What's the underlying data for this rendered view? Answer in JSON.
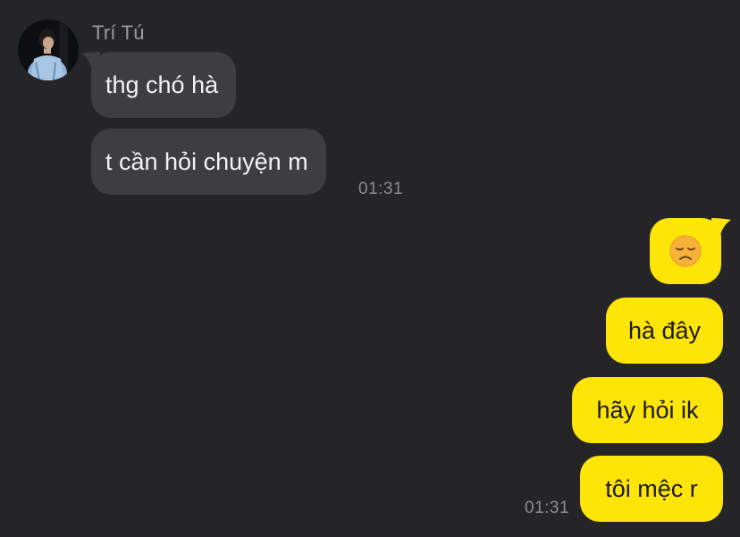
{
  "contact": {
    "name": "Trí Tú"
  },
  "incoming_messages": [
    {
      "text": "thg chó hà"
    },
    {
      "text": "t cần hỏi chuyện m",
      "time": "01:31"
    }
  ],
  "outgoing_messages": [
    {
      "text": "😞",
      "emoji_name": "disappointed-face"
    },
    {
      "text": "hà đây"
    },
    {
      "text": "hãy hỏi ik"
    },
    {
      "text": "tôi mệc r",
      "time": "01:31"
    }
  ],
  "colors": {
    "background": "#252527",
    "incoming_bubble": "#3e3e42",
    "outgoing_bubble": "#fde508",
    "sender_name": "#9c9ca2",
    "timestamp": "#8c8c92"
  }
}
